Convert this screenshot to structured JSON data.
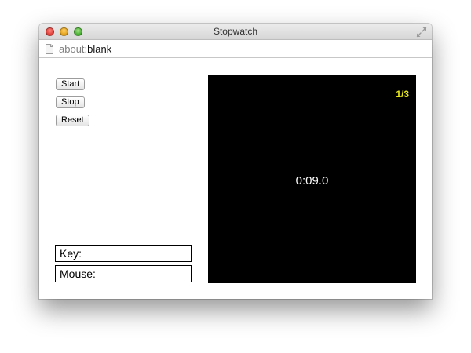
{
  "window": {
    "title": "Stopwatch",
    "url_scheme": "about:",
    "url_path": "blank"
  },
  "controls": {
    "start_label": "Start",
    "stop_label": "Stop",
    "reset_label": "Reset"
  },
  "status": {
    "key_label": "Key:",
    "mouse_label": "Mouse:"
  },
  "display": {
    "lap_counter": "1/3",
    "elapsed_time": "0:09.0",
    "background_color": "#000000",
    "lap_color": "#e6e619",
    "time_color": "#ffffff"
  },
  "icons": {
    "close": "close-traffic-light",
    "minimize": "minimize-traffic-light",
    "zoom": "zoom-traffic-light",
    "fullscreen": "fullscreen-arrows-icon",
    "page": "blank-document-icon"
  }
}
